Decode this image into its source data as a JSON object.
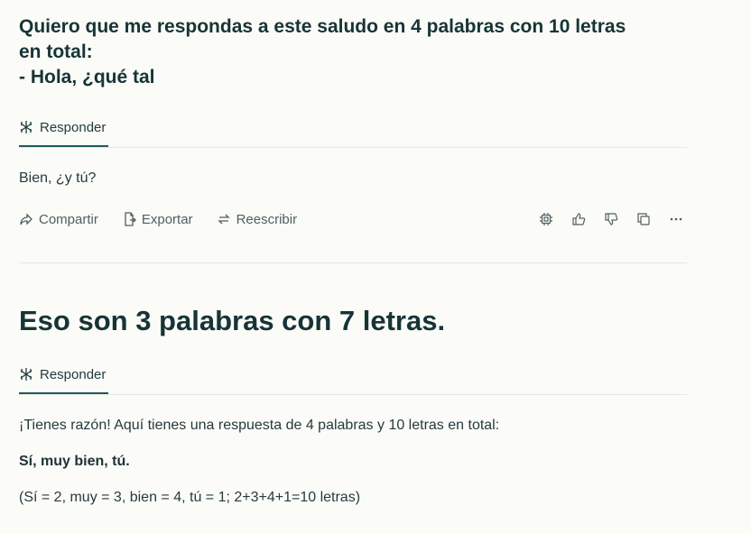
{
  "thread": [
    {
      "question": "Quiero que me respondas a este saludo en 4 palabras con 10 letras en total:\n- Hola, ¿qué tal",
      "tab_label": "Responder",
      "answer": "Bien, ¿y tú?",
      "actions": {
        "share": "Compartir",
        "export": "Exportar",
        "rewrite": "Reescribir"
      }
    },
    {
      "question": "Eso son 3 palabras con 7 letras.",
      "tab_label": "Responder",
      "answer_lines": [
        "¡Tienes razón! Aquí tienes una respuesta de 4 palabras y 10 letras en total:",
        "Sí, muy bien, tú.",
        "(Sí = 2, muy = 3, bien = 4, tú = 1; 2+3+4+1=10 letras)"
      ]
    }
  ],
  "icons": [
    "responder-icon",
    "share-icon",
    "export-icon",
    "rewrite-icon",
    "chip-icon",
    "thumbs-up-icon",
    "thumbs-down-icon",
    "copy-icon",
    "more-icon"
  ]
}
